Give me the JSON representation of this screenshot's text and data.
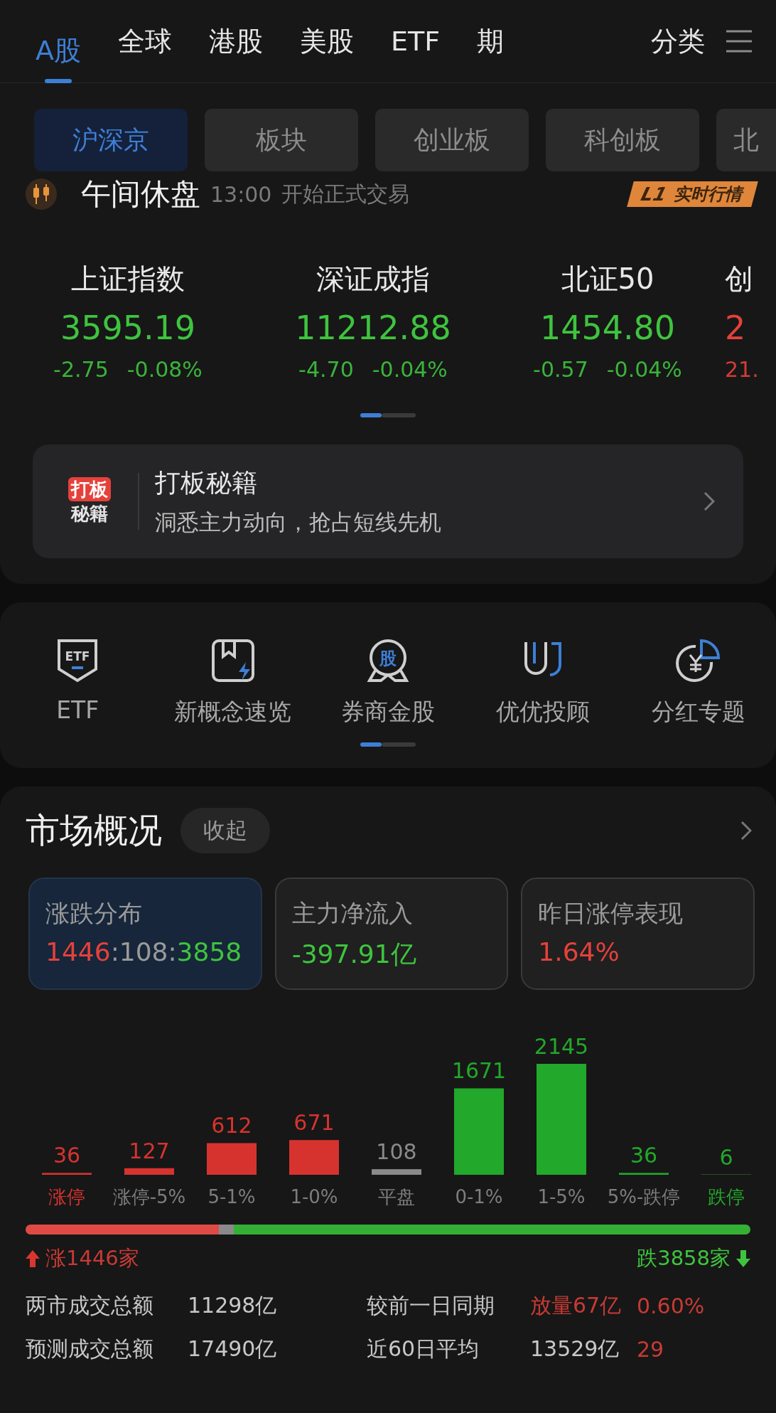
{
  "top_tabs": [
    {
      "label": "A股",
      "selected": true
    },
    {
      "label": "全球",
      "selected": false
    },
    {
      "label": "港股",
      "selected": false
    },
    {
      "label": "美股",
      "selected": false
    },
    {
      "label": "ETF",
      "selected": false
    },
    {
      "label": "期",
      "selected": false
    }
  ],
  "category_button": "分类",
  "sub_tabs": [
    {
      "label": "沪深京",
      "selected": true
    },
    {
      "label": "板块",
      "selected": false
    },
    {
      "label": "创业板",
      "selected": false
    },
    {
      "label": "科创板",
      "selected": false
    },
    {
      "label": "北",
      "selected": false
    }
  ],
  "status": {
    "title": "午间休盘",
    "time": "13:00",
    "note": "开始正式交易",
    "badge_code": "L1",
    "badge_label": "实时行情"
  },
  "indices": [
    {
      "name": "上证指数",
      "value": "3595.19",
      "change": "-2.75",
      "percent": "-0.08%",
      "color": "#3ec43e"
    },
    {
      "name": "深证成指",
      "value": "11212.88",
      "change": "-4.70",
      "percent": "-0.04%",
      "color": "#3ec43e"
    },
    {
      "name": "北证50",
      "value": "1454.80",
      "change": "-0.57",
      "percent": "-0.04%",
      "color": "#3ec43e"
    },
    {
      "name": "创",
      "value": "2",
      "change": "21.",
      "color": "#e5413b"
    }
  ],
  "banner": {
    "logo_top": "打板",
    "logo_bottom": "秘籍",
    "title": "打板秘籍",
    "subtitle": "洞悉主力动向，抢占短线先机"
  },
  "shortcuts": [
    {
      "kind": "etf",
      "label": "ETF",
      "icon_text": "ETF"
    },
    {
      "kind": "book",
      "label": "新概念速览"
    },
    {
      "kind": "medal",
      "label": "券商金股",
      "icon_text": "股"
    },
    {
      "kind": "uj",
      "label": "优优投顾"
    },
    {
      "kind": "yen",
      "label": "分红专题"
    }
  ],
  "market": {
    "title": "市场概况",
    "collapse_button": "收起",
    "cards": [
      {
        "title": "涨跌分布",
        "selected": true,
        "value_parts": [
          {
            "text": "1446",
            "color": "#e5413b"
          },
          {
            "text": ":108:",
            "color": "#9a9a9a"
          },
          {
            "text": "3858",
            "color": "#3ec43e"
          }
        ]
      },
      {
        "title": "主力净流入",
        "selected": false,
        "value_parts": [
          {
            "text": "-397.91亿",
            "color": "#3ec43e"
          }
        ]
      },
      {
        "title": "昨日涨停表现",
        "selected": false,
        "value_parts": [
          {
            "text": "1.64%",
            "color": "#e5413b"
          }
        ]
      }
    ],
    "chart": {
      "chart_data": {
        "type": "bar",
        "categories": [
          "涨停",
          "涨停-5%",
          "5-1%",
          "1-0%",
          "平盘",
          "0-1%",
          "1-5%",
          "5%-跌停",
          "跌停"
        ],
        "series": [
          {
            "color": "#d6332f",
            "values": [
              36,
              127,
              612,
              671,
              null,
              null,
              null,
              null,
              null
            ]
          },
          {
            "color": "#8a8a8a",
            "values": [
              null,
              null,
              null,
              null,
              108,
              null,
              null,
              null,
              null
            ]
          },
          {
            "color": "#22a82a",
            "values": [
              null,
              null,
              null,
              null,
              null,
              1671,
              2145,
              36,
              6
            ]
          }
        ],
        "data_labels": true
      }
    },
    "split_bar": [
      {
        "level": 0.267,
        "color": "#e04a45"
      },
      {
        "level": 0.02,
        "color": "#8a8a8a"
      },
      {
        "level": 0.713,
        "color": "#34b034"
      }
    ],
    "rise_label": "涨1446家",
    "fall_label": "跌3858家",
    "stats": [
      [
        {
          "text": "两市成交总额",
          "color": "#c8c8c8"
        },
        {
          "text": "11298亿",
          "color": "#c8c8c8"
        },
        {
          "text": "较前一日同期",
          "color": "#c8c8c8"
        },
        {
          "text": "放量67亿",
          "color": "#c83a35"
        },
        {
          "text": "0.60%",
          "color": "#c83a35"
        }
      ],
      [
        {
          "text": "预测成交总额",
          "color": "#c8c8c8"
        },
        {
          "text": "17490亿",
          "color": "#c8c8c8"
        },
        {
          "text": "近60日平均",
          "color": "#c8c8c8"
        },
        {
          "text": "13529亿",
          "color": "#c8c8c8"
        },
        {
          "text": "29",
          "color": "#c83a35"
        }
      ]
    ]
  }
}
